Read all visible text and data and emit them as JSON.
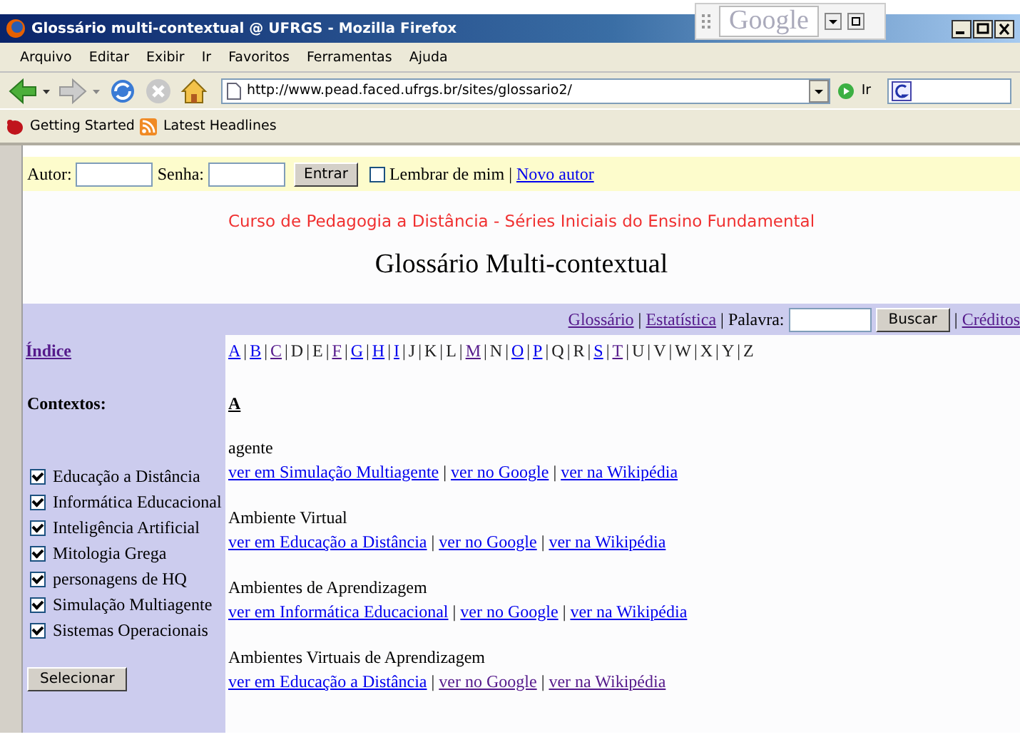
{
  "window": {
    "title": "Glossário multi-contextual @ UFRGS - Mozilla Firefox",
    "search_widget": "Google"
  },
  "menu": [
    "Arquivo",
    "Editar",
    "Exibir",
    "Ir",
    "Favoritos",
    "Ferramentas",
    "Ajuda"
  ],
  "address": {
    "value": "http://www.pead.faced.ufrgs.br/sites/glossario2/",
    "go_label": "Ir"
  },
  "bookmarks": [
    {
      "label": "Getting Started",
      "kind": "bug"
    },
    {
      "label": "Latest Headlines",
      "kind": "feed"
    }
  ],
  "separator": "|",
  "login": {
    "user_label": "Autor:",
    "password_label": "Senha:",
    "submit": "Entrar",
    "remember": {
      "label": "Lembrar de mim",
      "checked": false
    },
    "new_author": "Novo autor"
  },
  "subtitle": "Curso de Pedagogia a Distância - Séries Iniciais do Ensino Fundamental",
  "title": "Glossário Multi-contextual",
  "top_links": [
    {
      "label": "Glossário",
      "visited": true
    },
    {
      "label": "Estatística",
      "visited": true
    }
  ],
  "search": {
    "label": "Palavra:",
    "button": "Buscar"
  },
  "credits": {
    "label": "Créditos",
    "visited": true
  },
  "sidebar": {
    "index": {
      "label": "Índice",
      "visited": true
    },
    "contexts_heading": "Contextos:",
    "contexts": [
      {
        "label": "Educação a Distância",
        "checked": true
      },
      {
        "label": "Informática Educacional",
        "checked": true
      },
      {
        "label": "Inteligência Artificial",
        "checked": true
      },
      {
        "label": "Mitologia Grega",
        "checked": true
      },
      {
        "label": "personagens de HQ",
        "checked": true
      },
      {
        "label": "Simulação Multiagente",
        "checked": true
      },
      {
        "label": "Sistemas Operacionais",
        "checked": true
      }
    ],
    "button": "Selecionar"
  },
  "letters": [
    {
      "label": "A",
      "kind": "link"
    },
    {
      "label": "B",
      "kind": "link"
    },
    {
      "label": "C",
      "kind": "visited"
    },
    {
      "label": "D",
      "kind": "plain"
    },
    {
      "label": "E",
      "kind": "plain"
    },
    {
      "label": "F",
      "kind": "visited"
    },
    {
      "label": "G",
      "kind": "link"
    },
    {
      "label": "H",
      "kind": "link"
    },
    {
      "label": "I",
      "kind": "link"
    },
    {
      "label": "J",
      "kind": "plain"
    },
    {
      "label": "K",
      "kind": "plain"
    },
    {
      "label": "L",
      "kind": "plain"
    },
    {
      "label": "M",
      "kind": "visited"
    },
    {
      "label": "N",
      "kind": "plain"
    },
    {
      "label": "O",
      "kind": "link"
    },
    {
      "label": "P",
      "kind": "link"
    },
    {
      "label": "Q",
      "kind": "plain"
    },
    {
      "label": "R",
      "kind": "plain"
    },
    {
      "label": "S",
      "kind": "link"
    },
    {
      "label": "T",
      "kind": "visited"
    },
    {
      "label": "U",
      "kind": "plain"
    },
    {
      "label": "V",
      "kind": "plain"
    },
    {
      "label": "W",
      "kind": "plain"
    },
    {
      "label": "X",
      "kind": "plain"
    },
    {
      "label": "Y",
      "kind": "plain"
    },
    {
      "label": "Z",
      "kind": "plain"
    }
  ],
  "section": "A",
  "entries": [
    {
      "term": "agente",
      "links": [
        {
          "label": "ver em Simulação Multiagente",
          "visited": false
        },
        {
          "label": "ver no Google",
          "visited": false
        },
        {
          "label": "ver na Wikipédia",
          "visited": false
        }
      ]
    },
    {
      "term": "Ambiente Virtual",
      "links": [
        {
          "label": "ver em Educação a Distância",
          "visited": false
        },
        {
          "label": "ver no Google",
          "visited": false
        },
        {
          "label": "ver na Wikipédia",
          "visited": false
        }
      ]
    },
    {
      "term": "Ambientes de Aprendizagem",
      "links": [
        {
          "label": "ver em Informática Educacional",
          "visited": false
        },
        {
          "label": "ver no Google",
          "visited": false
        },
        {
          "label": "ver na Wikipédia",
          "visited": false
        }
      ]
    },
    {
      "term": "Ambientes Virtuais de Aprendizagem",
      "links": [
        {
          "label": "ver em Educação a Distância",
          "visited": false
        },
        {
          "label": "ver no Google",
          "visited": true
        },
        {
          "label": "ver na Wikipédia",
          "visited": true
        }
      ]
    }
  ]
}
